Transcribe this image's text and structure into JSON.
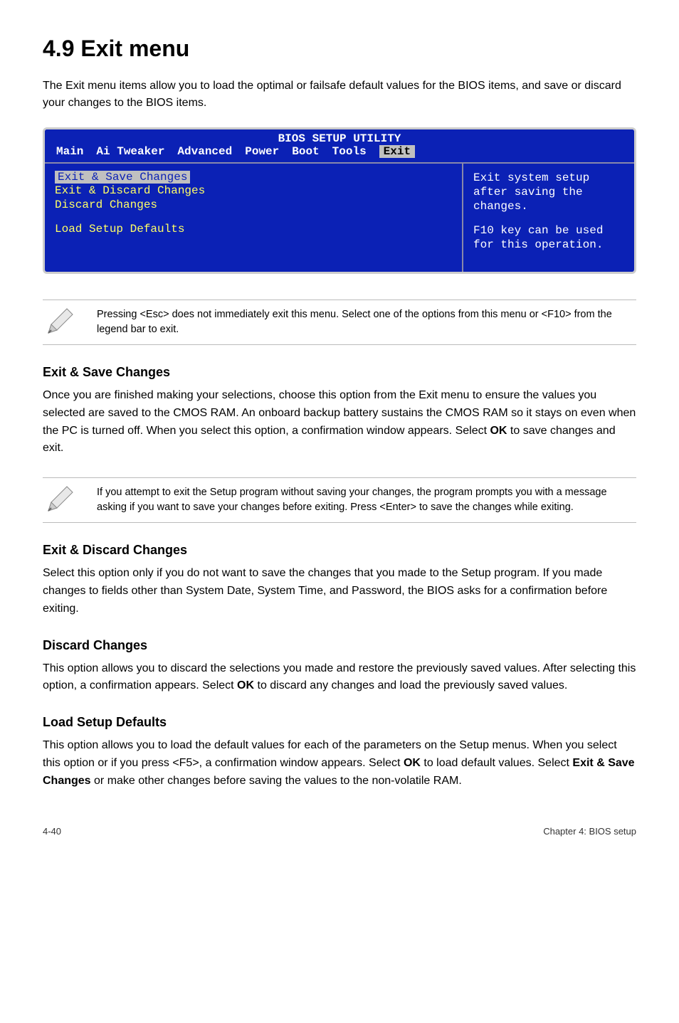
{
  "heading": "4.9    Exit menu",
  "intro": "The Exit menu items allow you to load the optimal or failsafe default values for the BIOS items, and save or discard your changes to the BIOS items.",
  "bios": {
    "title": "BIOS SETUP UTILITY",
    "tabs": [
      "Main",
      "Ai Tweaker",
      "Advanced",
      "Power",
      "Boot",
      "Tools"
    ],
    "tab_selected": "Exit",
    "menu": {
      "items": [
        "Exit & Save Changes",
        "Exit & Discard Changes",
        "Discard Changes"
      ],
      "separate_item": "Load Setup Defaults"
    },
    "help_line1": "Exit system setup after saving the changes.",
    "help_line2": "F10 key can be used for this operation."
  },
  "note1": "Pressing <Esc> does not immediately exit this menu. Select one of the options from this menu or <F10> from the legend bar to exit.",
  "sections": [
    {
      "title": "Exit & Save Changes",
      "body_parts": [
        "Once you are finished making your selections, choose this option from the Exit menu to ensure the values you selected are saved to the CMOS RAM. An onboard backup battery sustains the CMOS RAM so it stays on even when the PC is turned off. When you select this option, a confirmation window appears. Select ",
        "OK",
        " to save changes and exit."
      ]
    }
  ],
  "note2": " If you attempt to exit the Setup program without saving your changes, the program prompts you with a message asking if you want to save your changes before exiting. Press <Enter>  to save the  changes while exiting.",
  "sections2": [
    {
      "title": "Exit & Discard Changes",
      "body": "Select this option only if you do not want to save the changes that you  made to the Setup program. If you made changes to fields other than System Date, System Time, and Password, the BIOS asks for a confirmation before exiting."
    },
    {
      "title": "Discard Changes",
      "body_parts": [
        "This option allows you to discard the selections you made and restore the previously saved values. After selecting this option, a confirmation appears. Select ",
        "OK",
        " to discard any changes and load the previously saved values."
      ]
    },
    {
      "title": "Load Setup Defaults",
      "body_parts": [
        "This option allows you to load the default values for each of the parameters on the Setup menus. When you select this option or if you press <F5>, a confirmation window appears. Select ",
        "OK",
        " to load default values. Select ",
        "Exit & Save Changes",
        " or make other changes before saving the values to the non-volatile RAM."
      ]
    }
  ],
  "footer": {
    "page": "4-40",
    "chapter": "Chapter 4: BIOS setup"
  }
}
